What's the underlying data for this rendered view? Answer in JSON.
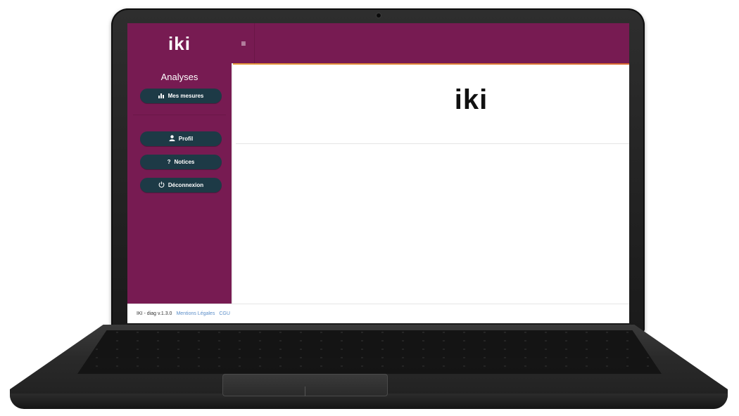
{
  "app": {
    "logo_text": "iki",
    "brand_color": "#771b52",
    "button_color": "#1d3a46"
  },
  "topbar": {
    "menu_icon": "hamburger-icon",
    "menu_glyph": "≡"
  },
  "sidebar": {
    "section_title": "Analyses",
    "items": [
      {
        "label": "Mes mesures",
        "icon": "bar-chart-icon",
        "glyph": "📊"
      },
      {
        "label": "Profil",
        "icon": "user-icon",
        "glyph": "👤"
      },
      {
        "label": "Notices",
        "icon": "question-icon",
        "glyph": "?"
      },
      {
        "label": "Déconnexion",
        "icon": "power-icon",
        "glyph": "⏻"
      }
    ]
  },
  "main": {
    "logo_text": "iki"
  },
  "footer": {
    "version": "IKI - diag v.1.3.0",
    "links": [
      "Mentions Légales",
      "CGU"
    ]
  }
}
